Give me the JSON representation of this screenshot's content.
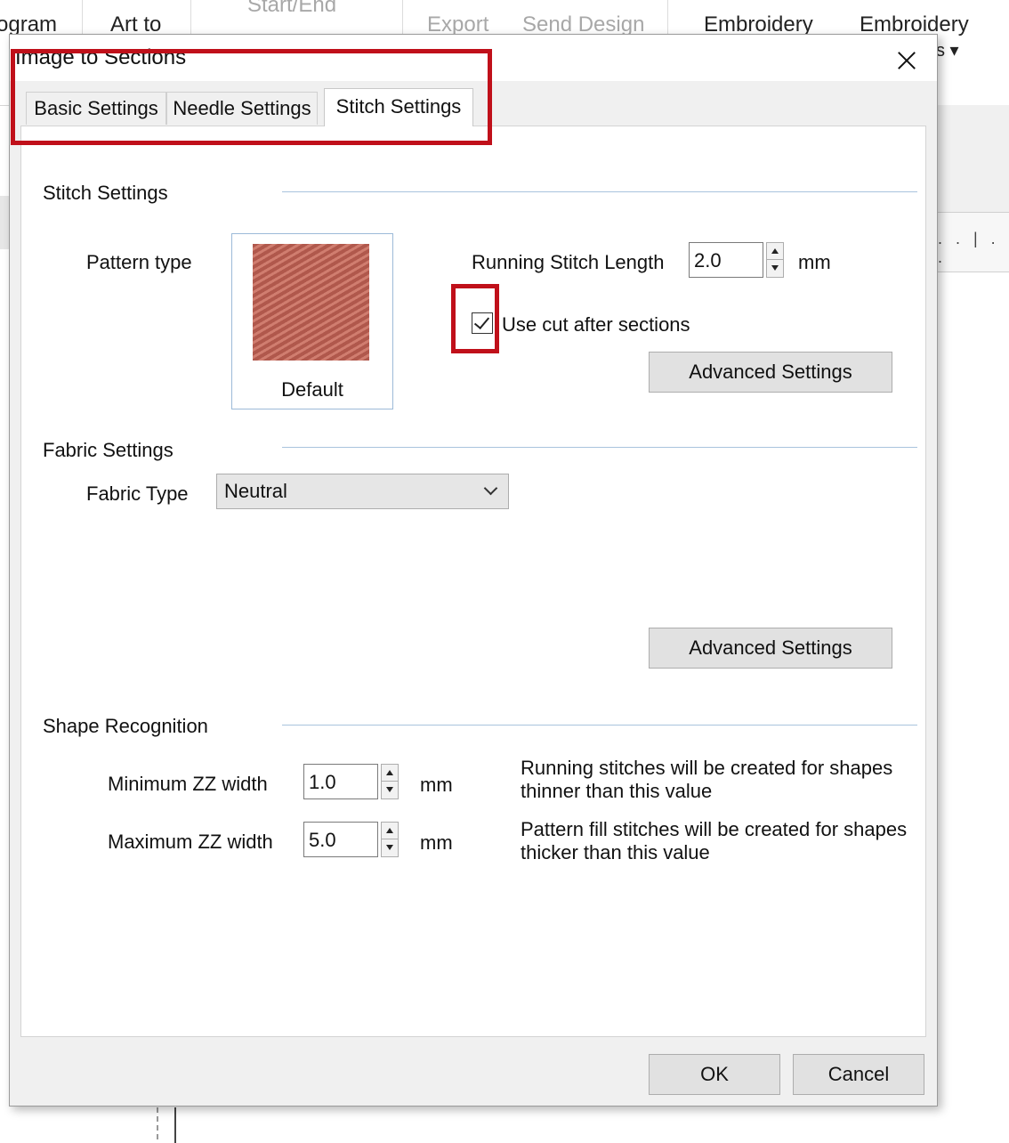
{
  "ribbon": {
    "items": [
      {
        "label": "ogram",
        "disabled": false
      },
      {
        "label": "Art to",
        "disabled": false
      },
      {
        "label": "Start/End",
        "disabled": true
      },
      {
        "label": "Export",
        "disabled": true
      },
      {
        "label": "Send Design",
        "disabled": true
      },
      {
        "label": "Embroidery",
        "disabled": false
      },
      {
        "label": "Embroidery",
        "disabled": false
      }
    ],
    "dropdown_suffix": "s ▾",
    "ruler_marks": ". . | . ."
  },
  "dialog": {
    "title": "Image to Sections",
    "tabs": [
      "Basic Settings",
      "Needle Settings",
      "Stitch Settings"
    ],
    "active_tab": "Stitch Settings",
    "stitch_settings": {
      "section_label": "Stitch Settings",
      "pattern_type_label": "Pattern type",
      "pattern_name": "Default",
      "running_stitch_label": "Running Stitch Length",
      "running_stitch_value": "2.0",
      "unit": "mm",
      "use_cut_label": "Use cut after sections",
      "use_cut_checked": true,
      "advanced_button": "Advanced Settings"
    },
    "fabric_settings": {
      "section_label": "Fabric Settings",
      "fabric_type_label": "Fabric Type",
      "fabric_type_value": "Neutral",
      "advanced_button": "Advanced Settings"
    },
    "shape_recognition": {
      "section_label": "Shape Recognition",
      "min_label": "Minimum ZZ width",
      "min_value": "1.0",
      "min_unit": "mm",
      "min_help_line1": "Running stitches will be created for shapes",
      "min_help_line2": "thinner than this value",
      "max_label": "Maximum ZZ width",
      "max_value": "5.0",
      "max_unit": "mm",
      "max_help_line1": "Pattern fill stitches will be created for shapes",
      "max_help_line2": "thicker than this value"
    },
    "buttons": {
      "ok": "OK",
      "cancel": "Cancel"
    }
  },
  "colors": {
    "highlight": "#c0101a",
    "pattern_dark": "#b0584c",
    "pattern_light": "#d07d6f",
    "divider": "#a9c4dd"
  }
}
